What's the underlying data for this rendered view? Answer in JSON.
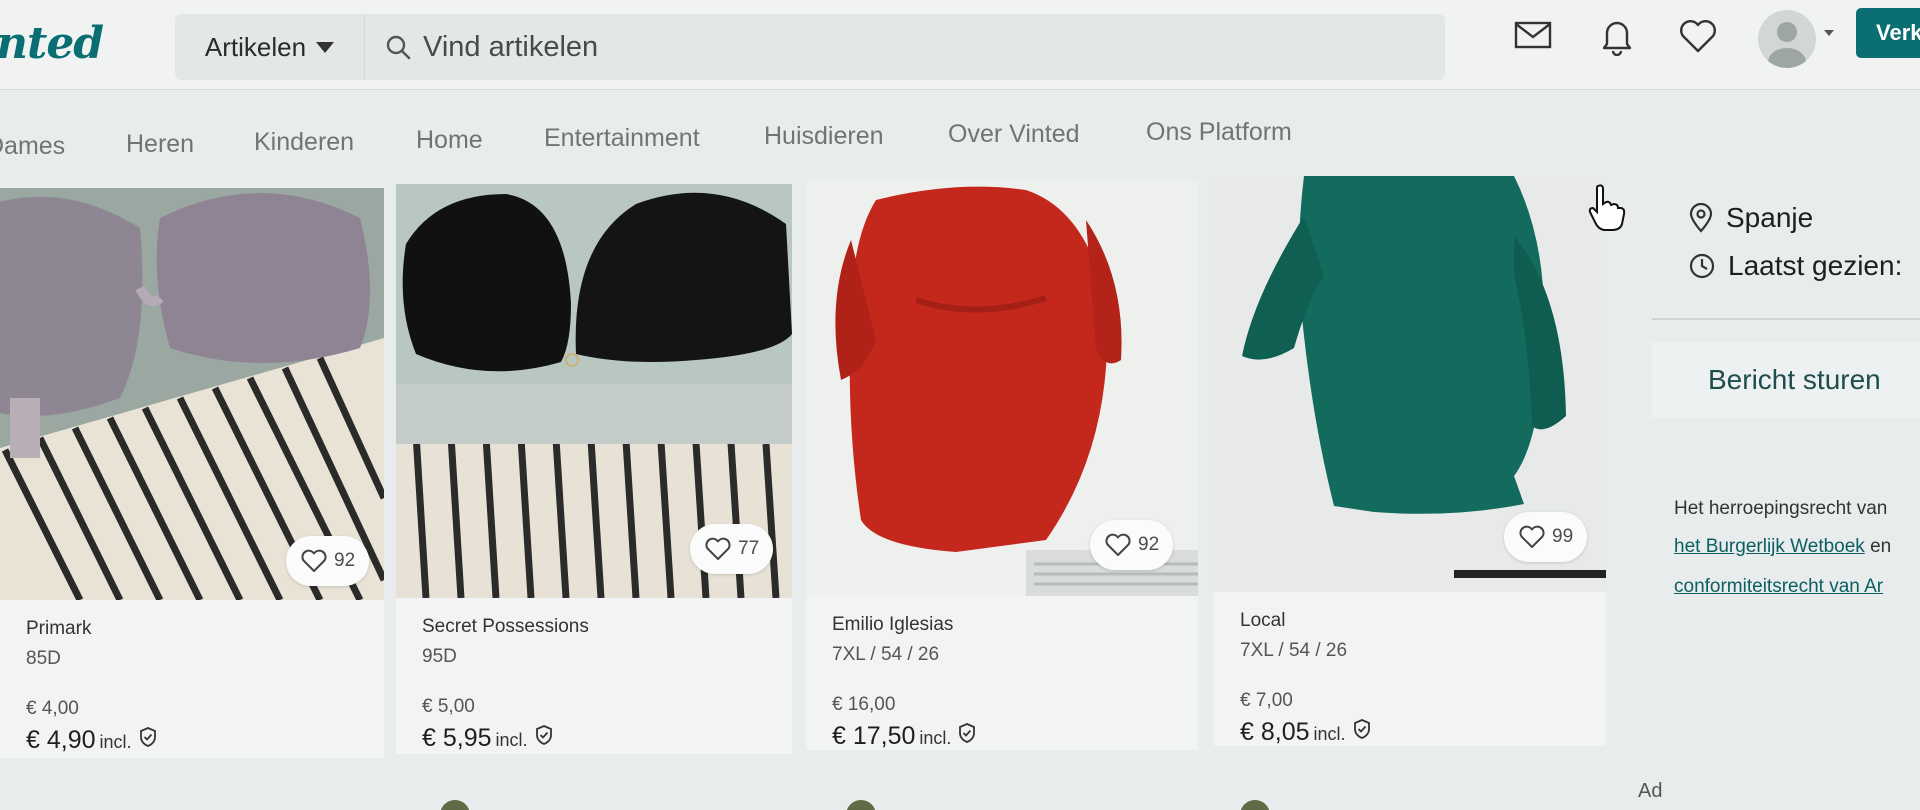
{
  "header": {
    "logo": "nted",
    "category_dropdown": "Artikelen",
    "search_placeholder": "Vind artikelen",
    "sell_button": "Verk",
    "icons": [
      "mail-icon",
      "bell-icon",
      "heart-icon",
      "avatar"
    ]
  },
  "nav": {
    "items": [
      "Dames",
      "Heren",
      "Kinderen",
      "Home",
      "Entertainment",
      "Huisdieren",
      "Over Vinted",
      "Ons Platform"
    ]
  },
  "products": [
    {
      "brand": "Primark",
      "size": "85D",
      "price": "€ 4,00",
      "total": "€ 4,90",
      "incl": "incl.",
      "likes": "92",
      "image": "lilac lace bra on striped towel"
    },
    {
      "brand": "Secret Possessions",
      "size": "95D",
      "price": "€ 5,00",
      "total": "€ 5,95",
      "incl": "incl.",
      "likes": "77",
      "image": "black strapless bra on striped towel"
    },
    {
      "brand": "Emilio Iglesias",
      "size": "7XL / 54 / 26",
      "price": "€ 16,00",
      "total": "€ 17,50",
      "incl": "incl.",
      "likes": "92",
      "image": "red satin dress on hanger"
    },
    {
      "brand": "Local",
      "size": "7XL / 54 / 26",
      "price": "€ 7,00",
      "total": "€ 8,05",
      "incl": "incl.",
      "likes": "99",
      "image": "green knit sweater on hanger"
    }
  ],
  "sidebar": {
    "location": "Spanje",
    "last_seen": "Laatst gezien:",
    "message_button": "Bericht sturen",
    "legal_line1": "Het herroepingsrecht van",
    "legal_link1": "het Burgerlijk Wetboek",
    "legal_link1_suffix": " en",
    "legal_link2": "conformiteitsrecht van Ar"
  },
  "ad_label": "Ad",
  "colors": {
    "brand": "#0b6e72",
    "background": "#e9ecec"
  }
}
